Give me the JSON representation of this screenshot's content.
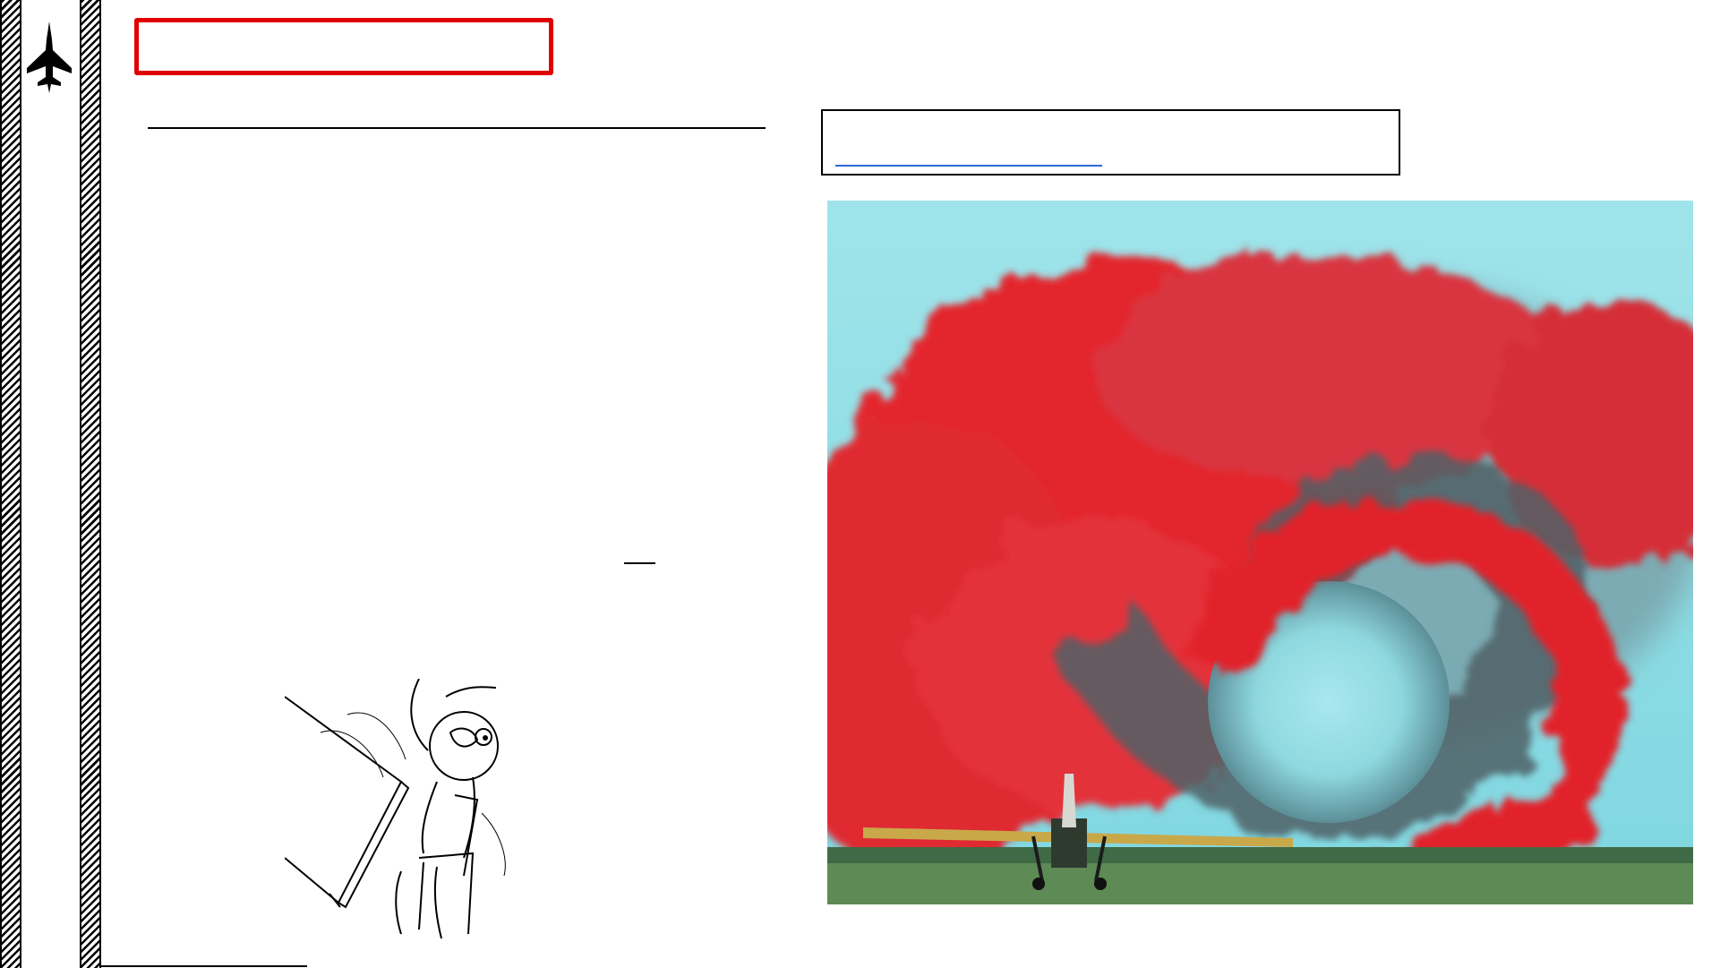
{
  "slide": {
    "title": "",
    "body_text": "",
    "caption_link": "",
    "footer": ""
  },
  "icons": {
    "header": "fighter-jet-icon"
  },
  "images": {
    "main_photo": "red-smoke-wingtip-vortex-with-crop-duster-plane",
    "comic": "rage-comic-table-flip-drawing"
  },
  "colors": {
    "title_border": "#e00000",
    "link": "#1f55c8",
    "smoke_red": "#e02a32",
    "sky": "#8fdde6"
  }
}
